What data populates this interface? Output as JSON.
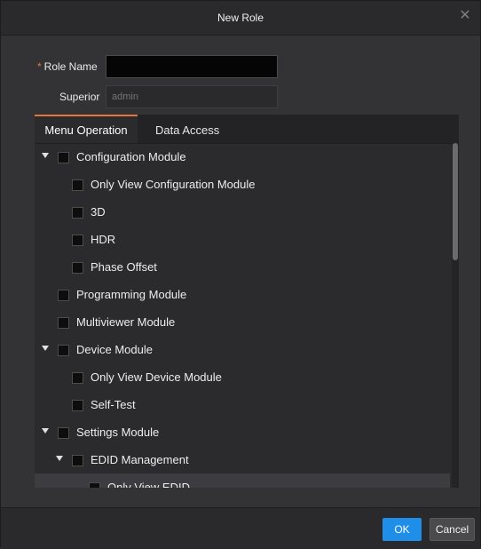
{
  "dialog": {
    "title": "New Role",
    "close_icon": "close-icon"
  },
  "form": {
    "role_name_required": "*",
    "role_name_label": "Role Name",
    "role_name_value": "",
    "superior_label": "Superior",
    "superior_placeholder": "admin"
  },
  "tabs": [
    {
      "label": "Menu Operation",
      "active": true
    },
    {
      "label": "Data Access",
      "active": false
    }
  ],
  "tree": [
    {
      "label": "Configuration Module",
      "level": 0,
      "expanded": true,
      "checked": false
    },
    {
      "label": "Only View Configuration Module",
      "level": 1,
      "checked": false
    },
    {
      "label": "3D",
      "level": 1,
      "checked": false
    },
    {
      "label": "HDR",
      "level": 1,
      "checked": false
    },
    {
      "label": "Phase Offset",
      "level": 1,
      "checked": false
    },
    {
      "label": "Programming Module",
      "level": 0,
      "checked": false
    },
    {
      "label": "Multiviewer Module",
      "level": 0,
      "checked": false
    },
    {
      "label": "Device Module",
      "level": 0,
      "expanded": true,
      "checked": false
    },
    {
      "label": "Only View Device Module",
      "level": 1,
      "checked": false
    },
    {
      "label": "Self-Test",
      "level": 1,
      "checked": false
    },
    {
      "label": "Settings Module",
      "level": 0,
      "expanded": true,
      "checked": false
    },
    {
      "label": "EDID Management",
      "level": 1,
      "expanded": true,
      "checked": false
    },
    {
      "label": "Only View EDID",
      "level": 2,
      "checked": false,
      "highlight": true
    }
  ],
  "footer": {
    "ok_label": "OK",
    "cancel_label": "Cancel"
  },
  "colors": {
    "accent": "#e2743c",
    "primary_button": "#1f8ee8"
  }
}
